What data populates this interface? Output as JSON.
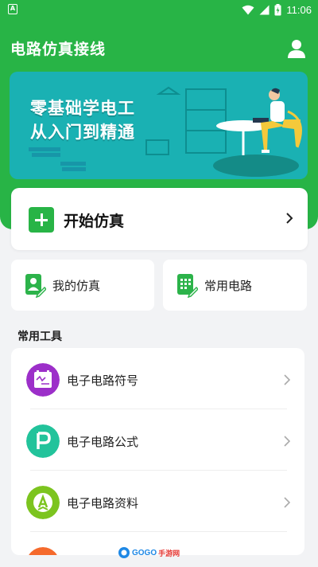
{
  "status_bar": {
    "notification_badge": "A",
    "time": "11:06",
    "icons": [
      "wifi-icon",
      "signal-icon",
      "battery-icon"
    ]
  },
  "header": {
    "title": "电路仿真接线",
    "user_icon": "user-icon",
    "brand_color": "#28b446"
  },
  "banner": {
    "line1": "零基础学电工",
    "line2": "从入门到精通",
    "background_color": "#1ab1b3"
  },
  "start_card": {
    "label": "开始仿真",
    "icon": "plus-icon"
  },
  "quick_actions": [
    {
      "label": "我的仿真",
      "icon": "my-simulation-icon"
    },
    {
      "label": "常用电路",
      "icon": "common-circuit-icon"
    }
  ],
  "tools_section": {
    "title": "常用工具",
    "items": [
      {
        "label": "电子电路符号",
        "icon": "circuit-symbol-icon",
        "color": "#9c2fc9"
      },
      {
        "label": "电子电路公式",
        "icon": "formula-p-icon",
        "color": "#22c39b"
      },
      {
        "label": "电子电路资料",
        "icon": "materials-icon",
        "color": "#7cc41f"
      },
      {
        "label": "",
        "icon": "fourth-tool-icon",
        "color": "#f56a2c"
      }
    ]
  },
  "watermark": {
    "text": "GOGO",
    "suffix": "手游网"
  }
}
